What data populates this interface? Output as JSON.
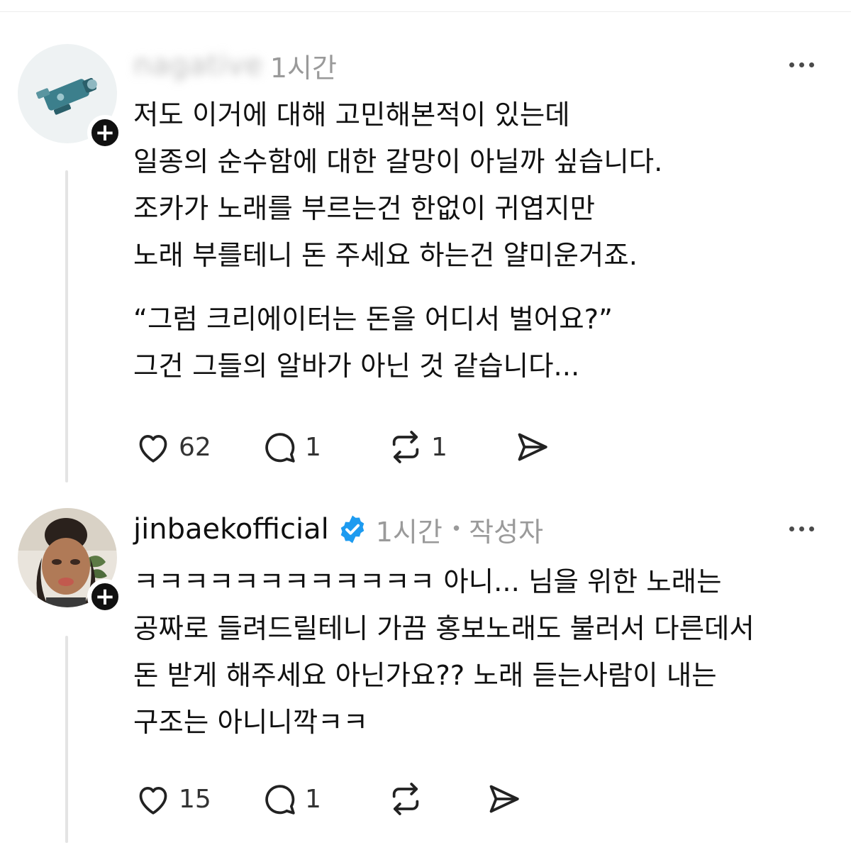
{
  "posts": [
    {
      "username": "",
      "verified": false,
      "time": "1시간",
      "author_badge": "",
      "lines": [
        "저도 이거에 대해 고민해본적이 있는데",
        "일종의 순수함에 대한 갈망이 아닐까 싶습니다.",
        "조카가 노래를 부르는건 한없이 귀엽지만",
        "노래 부를테니 돈 주세요 하는건 얄미운거죠.",
        "",
        "“그럼 크리에이터는 돈을 어디서 벌어요?”",
        "그건 그들의 알바가 아닌 것 같습니다..."
      ],
      "likes": "62",
      "replies": "1",
      "reposts": "1"
    },
    {
      "username": "jinbaekofficial",
      "verified": true,
      "time": "1시간",
      "author_badge": "작성자",
      "lines": [
        "ㅋㅋㅋㅋㅋㅋㅋㅋㅋㅋㅋㅋ 아니... 님을 위한 노래는",
        "공짜로 들려드릴테니 가끔 홍보노래도 불러서 다른데서",
        "돈 받게 해주세요 아닌가요?? 노래 듣는사람이 내는",
        "구조는 아니니깍ㅋㅋ"
      ],
      "likes": "15",
      "replies": "1",
      "reposts": ""
    }
  ],
  "icons": {
    "like": "heart-icon",
    "reply": "speech-bubble-icon",
    "repost": "repost-arrows-icon",
    "share": "paper-plane-icon",
    "verified": "verified-badge-icon",
    "more": "more-horizontal-icon",
    "follow": "plus-icon"
  },
  "colors": {
    "verified_badge": "#1d9bf0",
    "secondary_text": "#9a9a9a"
  }
}
